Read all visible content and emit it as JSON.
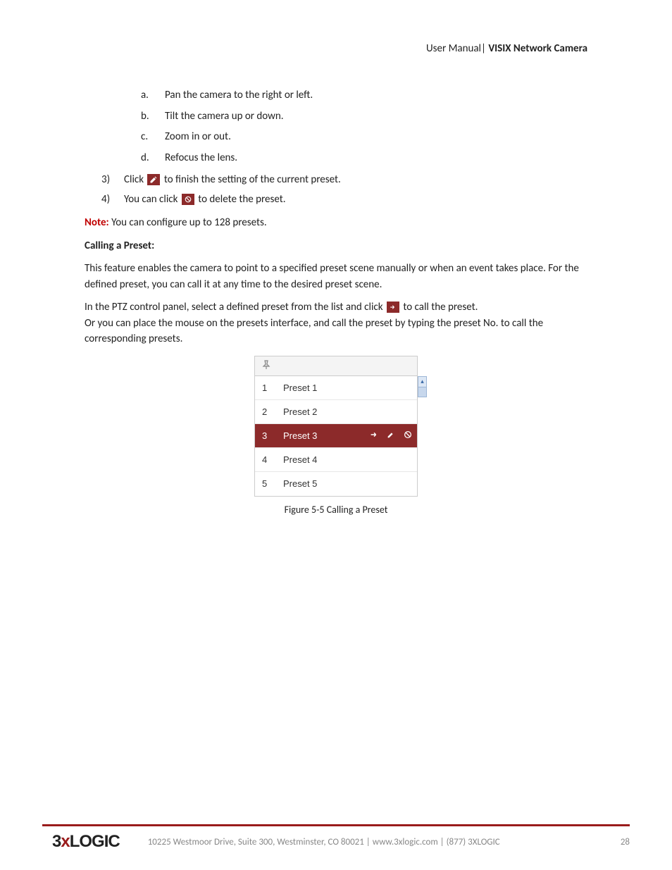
{
  "header": {
    "left": "User Manual",
    "sep": "|",
    "right": "VISIX Network Camera"
  },
  "sublist": {
    "a": "Pan the camera to the right or left.",
    "b": "Tilt the camera up or down.",
    "c": "Zoom in or out.",
    "d": "Refocus the lens."
  },
  "step3": {
    "num": "3)",
    "before": "Click",
    "after": "to finish the setting of the current preset."
  },
  "step4": {
    "num": "4)",
    "before": "You can click",
    "after": "to delete the preset."
  },
  "note": {
    "label": "Note:",
    "text": "You can configure up to 128 presets."
  },
  "calling_heading": "Calling a Preset:",
  "calling_p1": "This feature enables the camera to point to a specified preset scene manually or when an event takes place. For the defined preset, you can call it at any time to the desired preset scene.",
  "calling_p2a": "In the PTZ control panel, select a defined preset from the list and click",
  "calling_p2b": "to call the preset.",
  "calling_p3": "Or you can place the mouse on the presets interface, and call the preset by typing the preset No. to call the corresponding presets.",
  "preset_rows": {
    "r1": {
      "n": "1",
      "name": "Preset 1"
    },
    "r2": {
      "n": "2",
      "name": "Preset 2"
    },
    "r3": {
      "n": "3",
      "name": "Preset 3"
    },
    "r4": {
      "n": "4",
      "name": "Preset 4"
    },
    "r5": {
      "n": "5",
      "name": "Preset 5"
    }
  },
  "sublist_letters": {
    "a": "a.",
    "b": "b.",
    "c": "c.",
    "d": "d."
  },
  "figure": {
    "label": "Figure 5-5",
    "title": "Calling a Preset"
  },
  "footer": {
    "logo_pre": "3",
    "logo_x": "x",
    "logo_post": "Logic",
    "address": "10225 Westmoor Drive, Suite 300, Westminster, CO 80021 | www.3xlogic.com | (877) 3XLOGIC",
    "page": "28"
  }
}
